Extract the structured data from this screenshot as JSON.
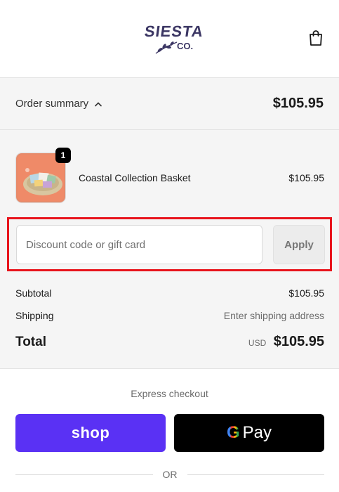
{
  "header": {
    "logo_word": "SIESTA",
    "logo_sub": "CO.",
    "logo_color": "#3c3764",
    "cart_icon": "shopping-bag-icon"
  },
  "order_summary_toggle": {
    "label": "Order summary",
    "chevron_icon": "chevron-up-icon",
    "total": "$105.95"
  },
  "line_items": [
    {
      "name": "Coastal Collection Basket",
      "price": "$105.95",
      "quantity": "1"
    }
  ],
  "discount": {
    "placeholder": "Discount code or gift card",
    "value": "",
    "apply_label": "Apply",
    "highlight_color": "#e8141c"
  },
  "costs": {
    "subtotal_label": "Subtotal",
    "subtotal_value": "$105.95",
    "shipping_label": "Shipping",
    "shipping_value": "Enter shipping address",
    "total_label": "Total",
    "currency": "USD",
    "total_value": "$105.95"
  },
  "express": {
    "heading": "Express checkout",
    "shop_pay_label": "shop",
    "shop_pay_color": "#5a31f4",
    "google_pay_g": "G",
    "google_pay_label": "Pay",
    "divider_label": "OR"
  }
}
